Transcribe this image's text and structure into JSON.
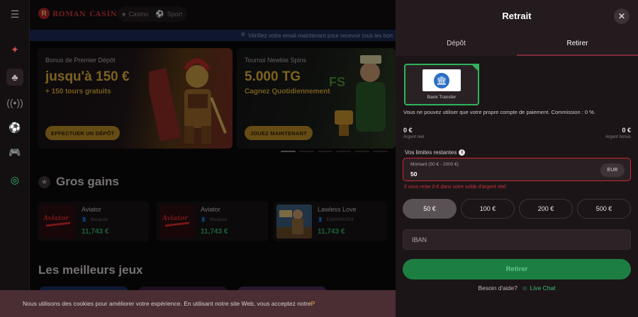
{
  "brand": {
    "logo_main": "ROMAN",
    "logo_suffix": "CASINO",
    "logo_badge": "R"
  },
  "nav": {
    "casino": "Casino",
    "sport": "Sport"
  },
  "banner": {
    "verify_text": "Vérifiez votre email maintenant pour recevoir tous les bon"
  },
  "promos": [
    {
      "kicker": "Bonus de Premier Dépôt",
      "headline": "jusqu'à 150 €",
      "sub": "+ 150 tours gratuits",
      "button": "EFFECTUER UN DÉPÔT"
    },
    {
      "kicker": "Tournoi Newbie Spins",
      "headline": "5.000 TG",
      "sub": "Cagnez Quotidiennement",
      "button": "JOUEZ MAINTENANT"
    }
  ],
  "sections": {
    "big_wins": "Gros gains",
    "best_games": "Les meilleurs jeux"
  },
  "wins": [
    {
      "game": "Aviator",
      "user": "Masquée",
      "amount": "11,743 €"
    },
    {
      "game": "Aviator",
      "user": "Masquée",
      "amount": "11,743 €"
    },
    {
      "game": "Lawless Love",
      "user": "Ewb94832024",
      "amount": "11,743 €"
    }
  ],
  "cookie": {
    "text": "Nous utilisons des cookies pour améliorer votre expérience. En utilisant notre site Web, vous acceptez notre ",
    "tail": "P"
  },
  "withdraw": {
    "title": "Retrait",
    "tab_deposit": "Dépôt",
    "tab_withdraw": "Retirer",
    "method_label": "Bank Transfer",
    "notice": "Vous ne pouvez utiliser que votre propre compte de paiement. Commission : 0 %.",
    "real_balance_value": "0 €",
    "real_balance_label": "Argent réel",
    "bonus_balance_value": "0 €",
    "bonus_balance_label": "Argent bonus",
    "limits_label": "Vos limites restantes",
    "amount_label": "Montant (50 € - 2000 €)",
    "amount_value": "50",
    "currency": "EUR",
    "error": "Il vous reste 0 € dans votre solde d'argent réel",
    "quick_amounts": [
      "50 €",
      "100 €",
      "200 €",
      "500 €"
    ],
    "iban_placeholder": "IBAN",
    "submit": "Retirer",
    "help_question": "Besoin d'aide?",
    "live_chat": "Live Chat"
  },
  "colors": {
    "accent_green": "#1d7e42",
    "error_red": "#c52a36",
    "gold": "#e3b33a"
  }
}
